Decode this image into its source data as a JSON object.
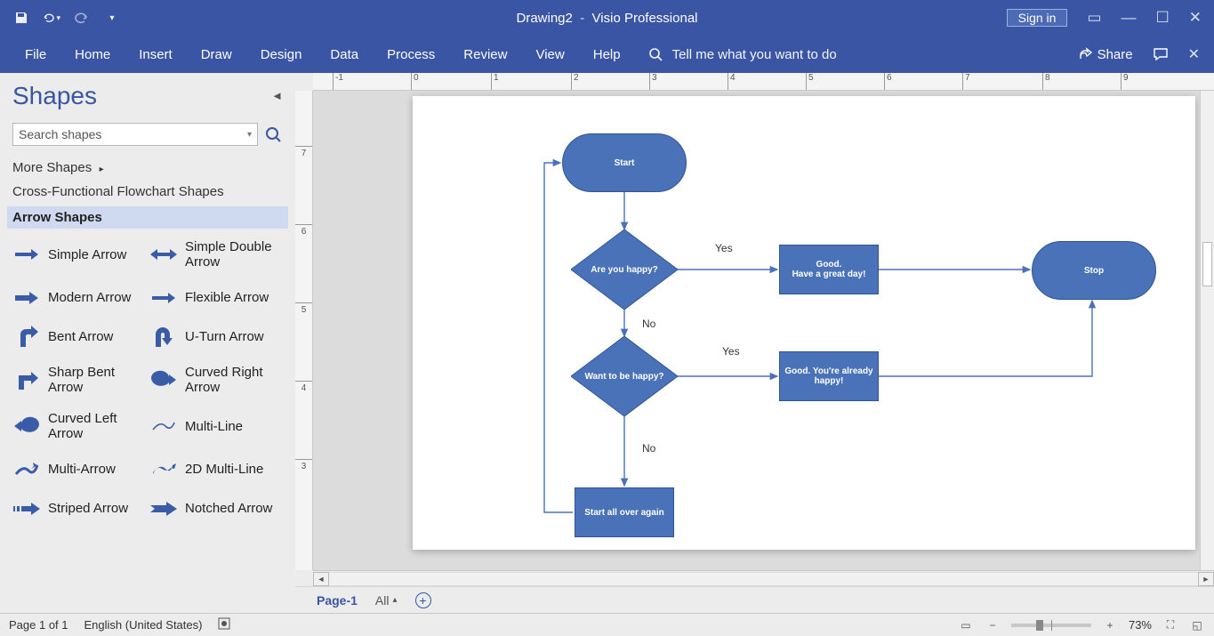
{
  "titlebar": {
    "doc_name": "Drawing2",
    "app_name": "Visio Professional",
    "signin": "Sign in"
  },
  "ribbon": {
    "tabs": [
      "File",
      "Home",
      "Insert",
      "Draw",
      "Design",
      "Data",
      "Process",
      "Review",
      "View",
      "Help"
    ],
    "tell_me": "Tell me what you want to do",
    "share": "Share"
  },
  "sidebar": {
    "title": "Shapes",
    "search_placeholder": "Search shapes",
    "more": "More Shapes",
    "stencils": {
      "link1": "Cross-Functional Flowchart Shapes",
      "active": "Arrow Shapes"
    },
    "shapes": [
      "Simple Arrow",
      "Simple Double Arrow",
      "Modern Arrow",
      "Flexible Arrow",
      "Bent Arrow",
      "U-Turn Arrow",
      "Sharp Bent Arrow",
      "Curved Right Arrow",
      "Curved Left Arrow",
      "Multi-Line",
      "Multi-Arrow",
      "2D Multi-Line",
      "Striped Arrow",
      "Notched Arrow"
    ]
  },
  "ruler_h": [
    "-1",
    "0",
    "1",
    "2",
    "3",
    "4",
    "5",
    "6",
    "7",
    "8",
    "9"
  ],
  "ruler_v": [
    "7",
    "6",
    "5",
    "4",
    "3"
  ],
  "flowchart": {
    "start": "Start",
    "stop": "Stop",
    "dec1": "Are you happy?",
    "dec2": "Want to be happy?",
    "proc1_l1": "Good.",
    "proc1_l2": "Have a great day!",
    "proc2_l1": "Good. You're already",
    "proc2_l2": "happy!",
    "proc3": "Start all over again",
    "yes": "Yes",
    "no": "No"
  },
  "pagetabs": {
    "page1": "Page-1",
    "all": "All"
  },
  "status": {
    "page": "Page 1 of 1",
    "lang": "English (United States)",
    "zoom": "73%"
  }
}
